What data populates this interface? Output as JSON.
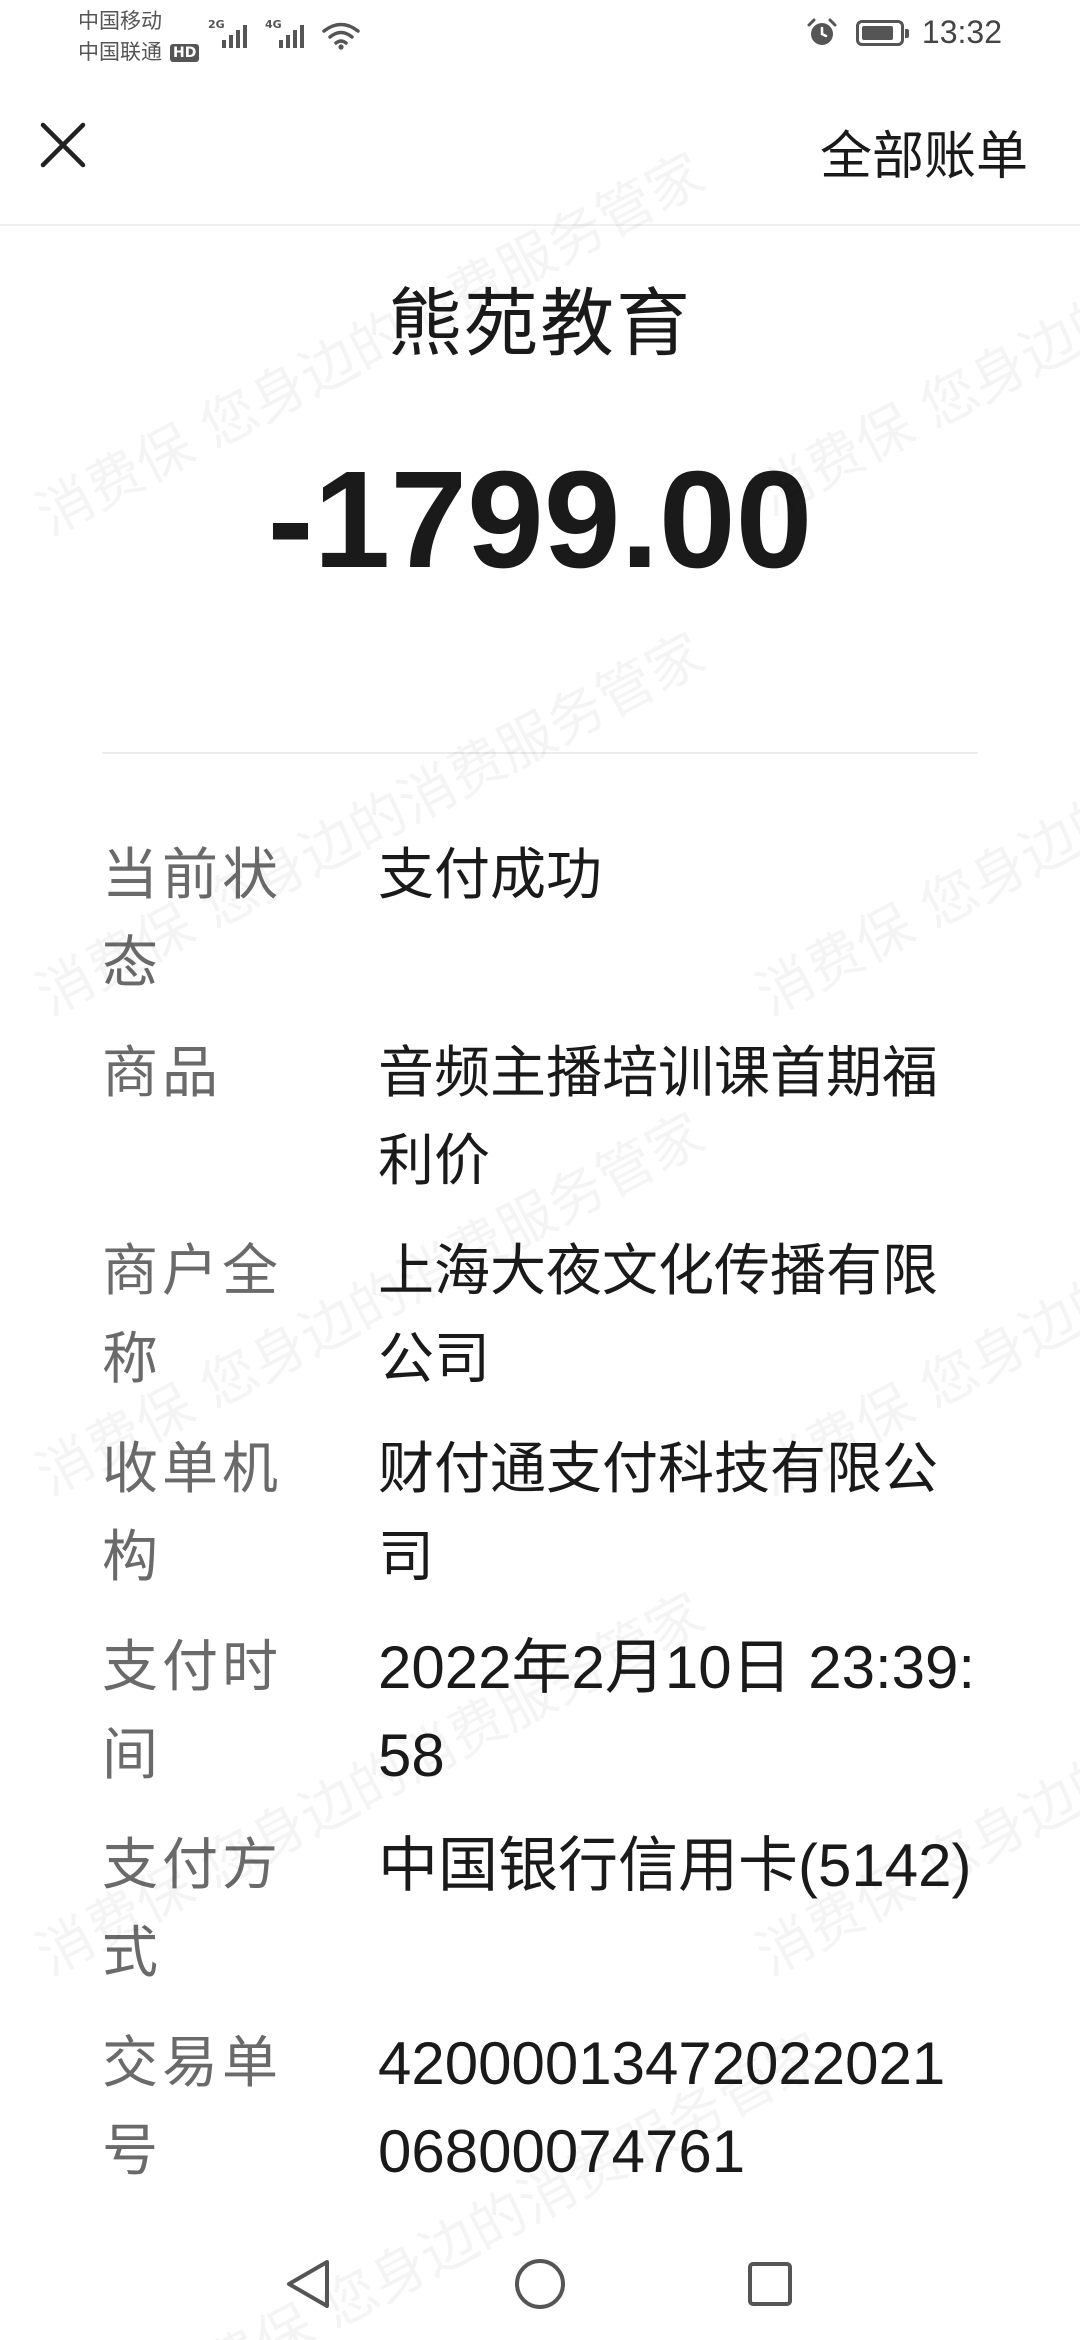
{
  "status_bar": {
    "carrier_1": "中国移动",
    "carrier_2": "中国联通",
    "hd_badge": "HD",
    "signal_1_tag": "2G",
    "signal_2_tag": "4G",
    "time": "13:32",
    "battery_level": 0.85
  },
  "nav": {
    "close_icon": "close-icon",
    "all_bills_label": "全部账单"
  },
  "bill": {
    "merchant": "熊苑教育",
    "amount": "-1799.00"
  },
  "details": [
    {
      "label": "当前状态",
      "value": "支付成功"
    },
    {
      "label": "商品",
      "value": "音频主播培训课首期福利价"
    },
    {
      "label": "商户全称",
      "value": "上海大夜文化传播有限公司"
    },
    {
      "label": "收单机构",
      "value": "财付通支付科技有限公司"
    },
    {
      "label": "支付时间",
      "value": "2022年2月10日 23:39:58"
    },
    {
      "label": "支付方式",
      "value": "中国银行信用卡(5142)"
    },
    {
      "label": "交易单号",
      "value": "4200001347202202106800074761"
    }
  ],
  "watermark": {
    "text": "消费保 您身边的消费服务管家"
  },
  "colors": {
    "text_primary": "#1a1a1a",
    "text_secondary": "#6a6a6a",
    "divider": "#ececec",
    "background": "#ffffff"
  }
}
